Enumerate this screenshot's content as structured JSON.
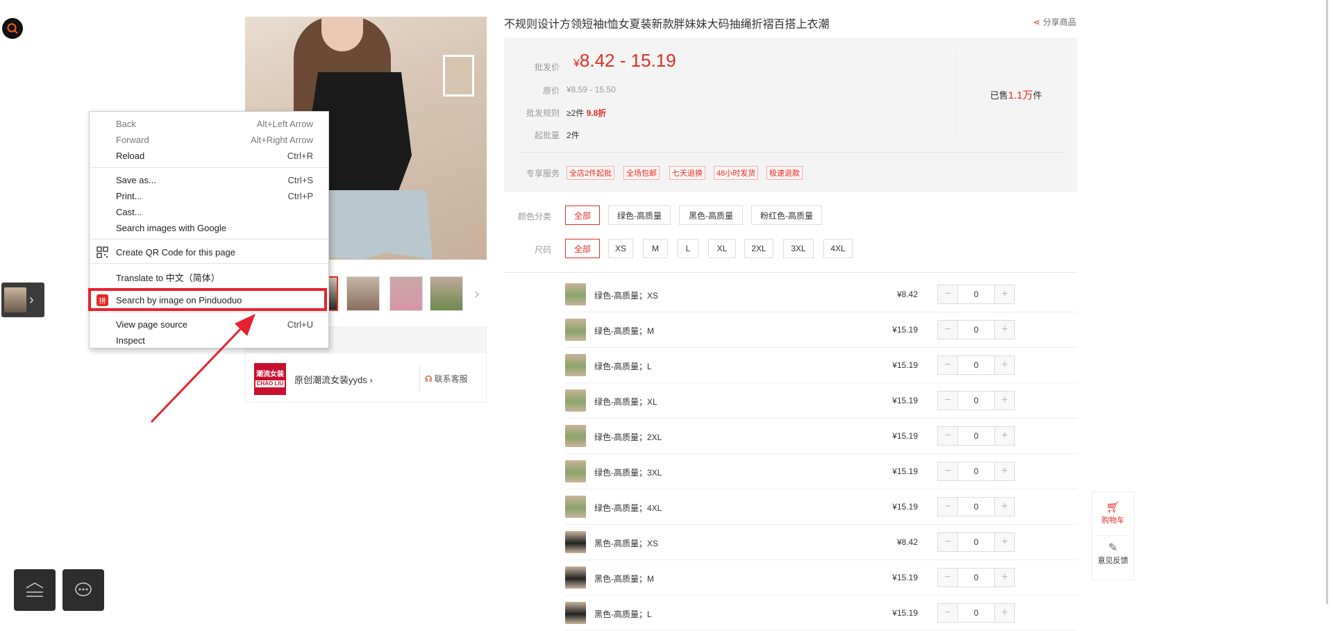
{
  "product": {
    "title": "不规则设计方领短袖t恤女夏装新款胖妹妹大码抽绳折褶百搭上衣潮",
    "share_label": "分享商品"
  },
  "price": {
    "wholesale_label": "批发价",
    "yen": "¥",
    "wholesale_range": "8.42 - 15.19",
    "original_label": "原价",
    "original_range": "¥8.59 - 15.50",
    "rule_label": "批发规则",
    "rule_text": "≥2件",
    "rule_discount": "9.8折",
    "min_label": "起批量",
    "min_value": "2件",
    "sold_prefix": "已售",
    "sold_num": "1.1万",
    "sold_suffix": "件",
    "service_label": "专享服务",
    "services": [
      "全店2件起批",
      "全场包邮",
      "七天退换",
      "48小时发货",
      "极速退款"
    ]
  },
  "options": {
    "color_label": "颜色分类",
    "colors": [
      "全部",
      "绿色-高质量",
      "黑色-高质量",
      "粉红色-高质量"
    ],
    "size_label": "尺码",
    "sizes": [
      "全部",
      "XS",
      "M",
      "L",
      "XL",
      "2XL",
      "3XL",
      "4XL"
    ]
  },
  "skus": [
    {
      "name": "绿色-高质量；XS",
      "price": "¥8.42",
      "qty": "0",
      "color": "#8aa56a"
    },
    {
      "name": "绿色-高质量；M",
      "price": "¥15.19",
      "qty": "0",
      "color": "#8aa56a"
    },
    {
      "name": "绿色-高质量；L",
      "price": "¥15.19",
      "qty": "0",
      "color": "#8aa56a"
    },
    {
      "name": "绿色-高质量；XL",
      "price": "¥15.19",
      "qty": "0",
      "color": "#8aa56a"
    },
    {
      "name": "绿色-高质量；2XL",
      "price": "¥15.19",
      "qty": "0",
      "color": "#8aa56a"
    },
    {
      "name": "绿色-高质量；3XL",
      "price": "¥15.19",
      "qty": "0",
      "color": "#8aa56a"
    },
    {
      "name": "绿色-高质量；4XL",
      "price": "¥15.19",
      "qty": "0",
      "color": "#8aa56a"
    },
    {
      "name": "黑色-高质量；XS",
      "price": "¥8.42",
      "qty": "0",
      "color": "#222222"
    },
    {
      "name": "黑色-高质量；M",
      "price": "¥15.19",
      "qty": "0",
      "color": "#222222"
    },
    {
      "name": "黑色-高质量；L",
      "price": "¥15.19",
      "qty": "0",
      "color": "#222222"
    }
  ],
  "store": {
    "logo_cn": "潮流女装",
    "logo_en": "CHAO LIU",
    "name": "原创潮流女装yyds ›",
    "contact": "联系客服"
  },
  "float": {
    "cart": "购物车",
    "feedback": "意见反馈"
  },
  "context_menu": {
    "items": [
      {
        "label": "Back",
        "shortcut": "Alt+Left Arrow"
      },
      {
        "label": "Forward",
        "shortcut": "Alt+Right Arrow"
      },
      {
        "label": "Reload",
        "shortcut": "Ctrl+R"
      },
      {
        "label": "Save as...",
        "shortcut": "Ctrl+S"
      },
      {
        "label": "Print...",
        "shortcut": "Ctrl+P"
      },
      {
        "label": "Cast...",
        "shortcut": ""
      },
      {
        "label": "Search images with Google",
        "shortcut": ""
      },
      {
        "label": "Create QR Code for this page",
        "shortcut": ""
      },
      {
        "label": "Translate to 中文（简体）",
        "shortcut": ""
      },
      {
        "label": "Search by image on Pinduoduo",
        "shortcut": ""
      },
      {
        "label": "View page source",
        "shortcut": "Ctrl+U"
      },
      {
        "label": "Inspect",
        "shortcut": ""
      }
    ],
    "pdd_icon_text": "拼"
  },
  "colors": {
    "accent": "#e02e24",
    "highlight": "#e8212e"
  }
}
